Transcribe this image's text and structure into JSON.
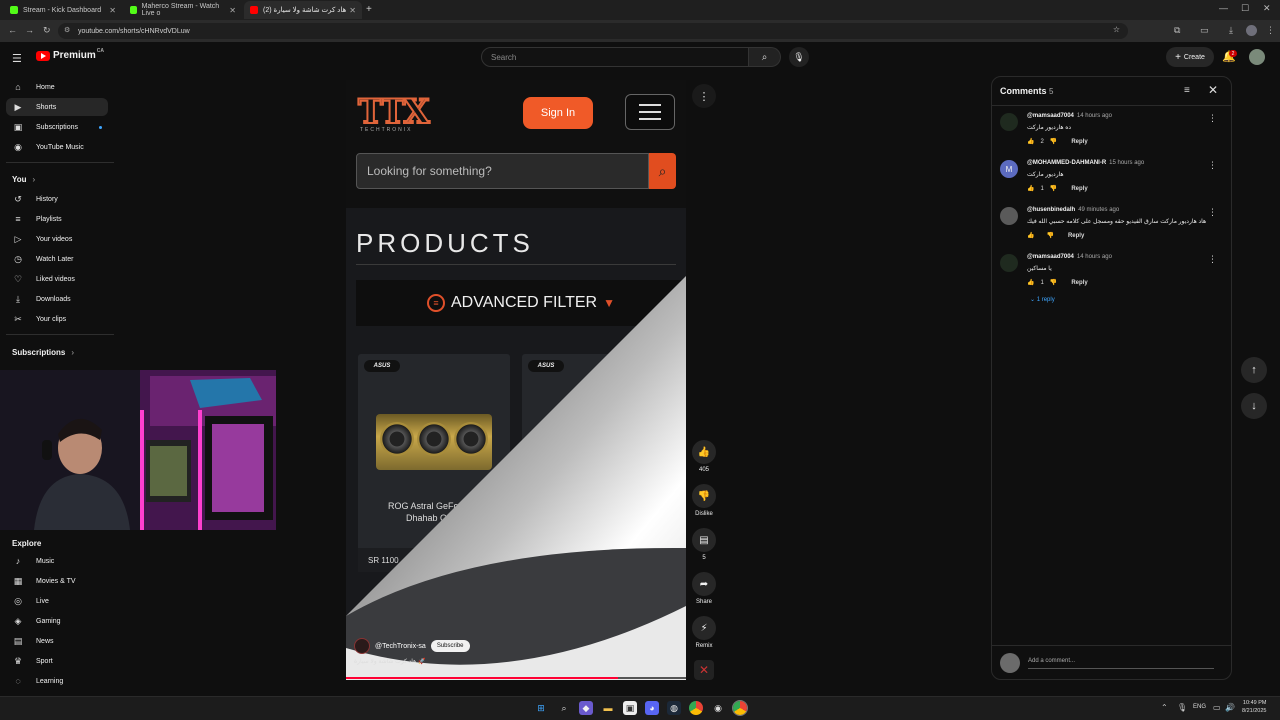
{
  "browser": {
    "tabs": [
      {
        "title": "Stream - Kick Dashboard",
        "color": "#53fc18",
        "active": false
      },
      {
        "title": "Maherco Stream - Watch Live o",
        "color": "#53fc18",
        "active": false
      },
      {
        "title": "هاد كرت شاشة ولا سيارة (2)",
        "color": "#ff0000",
        "active": true
      }
    ],
    "new_tab": "+",
    "url": "youtube.com/shorts/cHNRvdVDLuw"
  },
  "youtube": {
    "logo": "Premium",
    "logo_region": "CA",
    "search_placeholder": "Search",
    "create_label": "Create",
    "notifications": "2"
  },
  "sidebar": {
    "main": [
      {
        "label": "Home",
        "icon": "⌂"
      },
      {
        "label": "Shorts",
        "icon": "▶",
        "active": true
      },
      {
        "label": "Subscriptions",
        "icon": "▣"
      },
      {
        "label": "YouTube Music",
        "icon": "◉"
      }
    ],
    "you_header": "You",
    "you": [
      {
        "label": "History",
        "icon": "↺"
      },
      {
        "label": "Playlists",
        "icon": "≡"
      },
      {
        "label": "Your videos",
        "icon": "▷"
      },
      {
        "label": "Watch Later",
        "icon": "◷"
      },
      {
        "label": "Liked videos",
        "icon": "♡"
      },
      {
        "label": "Downloads",
        "icon": "⤓"
      },
      {
        "label": "Your clips",
        "icon": "✂"
      }
    ],
    "subscriptions_header": "Subscriptions",
    "explore_header": "Explore",
    "explore": [
      {
        "label": "Music",
        "icon": "♪"
      },
      {
        "label": "Movies & TV",
        "icon": "▦"
      },
      {
        "label": "Live",
        "icon": "◎"
      },
      {
        "label": "Gaming",
        "icon": "◈"
      },
      {
        "label": "News",
        "icon": "▤"
      },
      {
        "label": "Sport",
        "icon": "♛"
      },
      {
        "label": "Learning",
        "icon": "◌"
      }
    ]
  },
  "short": {
    "site": {
      "brand": "TTX",
      "brand_sub": "TECHTRONIX",
      "signin": "Sign In",
      "search_placeholder": "Looking for something?",
      "products_heading": "PRODUCTS",
      "filter_label": "ADVANCED FILTER",
      "badge": "ASUS",
      "product_name_line1": "ROG Astral GeForce R",
      "product_name_line2": "Dhahab OC E",
      "price": "SR 1100"
    },
    "channel": "@TechTronix-sa",
    "subscribe": "Subscribe",
    "title": "هاد كرت شاشة ولا سيارة 🚀",
    "progress": 0.8,
    "actions": {
      "likes": "405",
      "dislike": "Dislike",
      "comments": "5",
      "share": "Share",
      "remix": "Remix"
    }
  },
  "comments_panel": {
    "title": "Comments",
    "count": "5",
    "comments": [
      {
        "user": "@mamsaad7004",
        "time": "14 hours ago",
        "text": "ده هارديور ماركت",
        "likes": "2",
        "reply": "Reply",
        "avatar_color": "#1f2a1f",
        "initial": ""
      },
      {
        "user": "@MOHAMMED-DAHMANI-R",
        "time": "15 hours ago",
        "text": "هارديور ماركت",
        "likes": "1",
        "reply": "Reply",
        "avatar_color": "#5c6bc0",
        "initial": "M"
      },
      {
        "user": "@husenbinedalh",
        "time": "49 minutes ago",
        "text": "هاد هارديور ماركت سارق الفيديو حقه ومسجل على كلامه حسبي الله فيك",
        "likes": "",
        "reply": "Reply",
        "avatar_color": "#5a5a5a",
        "initial": ""
      },
      {
        "user": "@mamsaad7004",
        "time": "14 hours ago",
        "text": "يا مساكين",
        "likes": "1",
        "reply": "Reply",
        "avatar_color": "#1f2a1f",
        "initial": ""
      }
    ],
    "replies_link": "1 reply",
    "add_comment_placeholder": "Add a comment..."
  },
  "taskbar": {
    "lang": "ENG",
    "time": "10:49 PM",
    "date": "8/21/2025"
  }
}
